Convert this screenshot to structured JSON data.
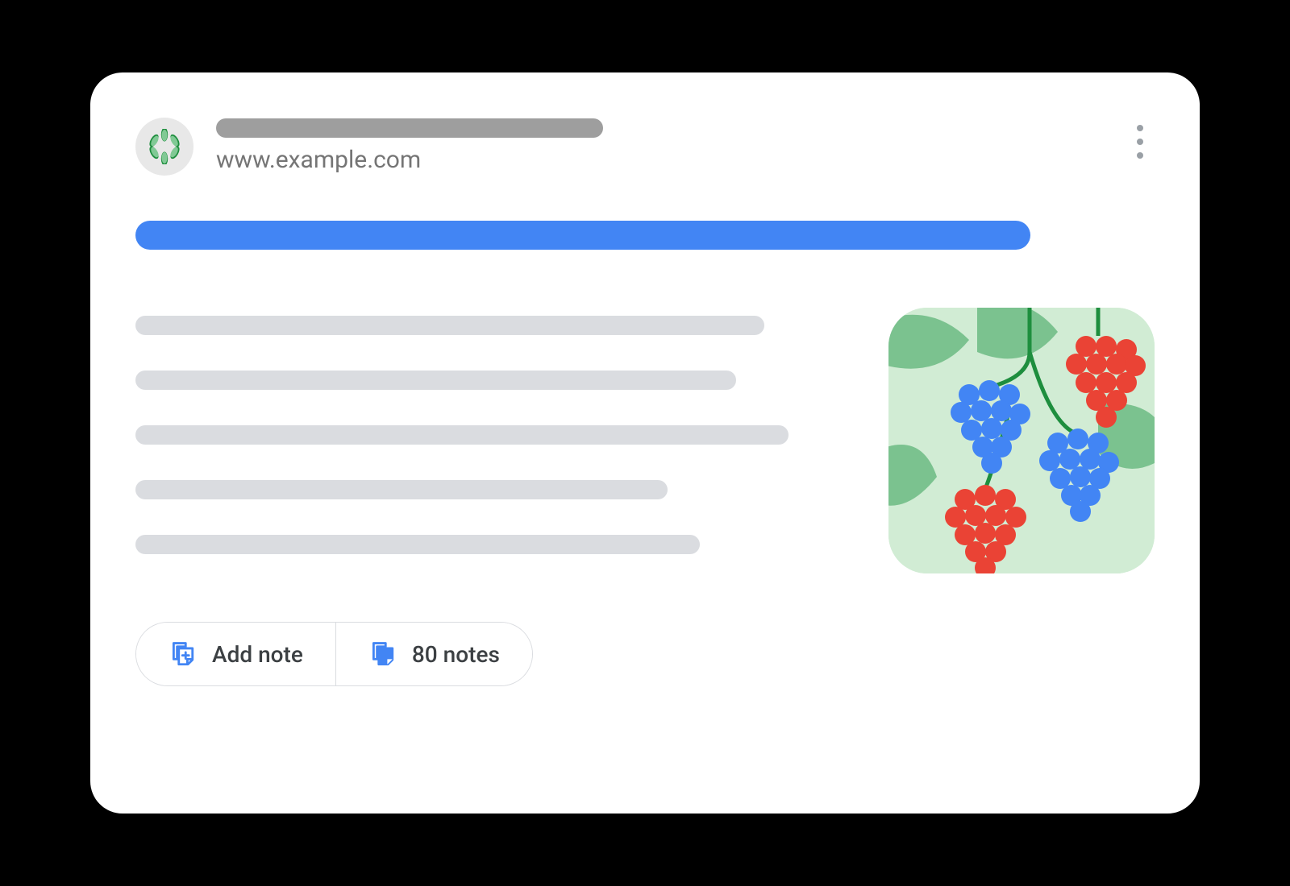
{
  "site": {
    "url": "www.example.com",
    "favicon_name": "leaf-flower-icon"
  },
  "snippet_widths": [
    780,
    745,
    810,
    660,
    700
  ],
  "actions": {
    "add_label": "Add note",
    "notes_count": 80,
    "notes_label": "80 notes"
  },
  "colors": {
    "accent": "#4285f4",
    "placeholder_dark": "#9e9e9e",
    "placeholder_light": "#dadce0"
  }
}
